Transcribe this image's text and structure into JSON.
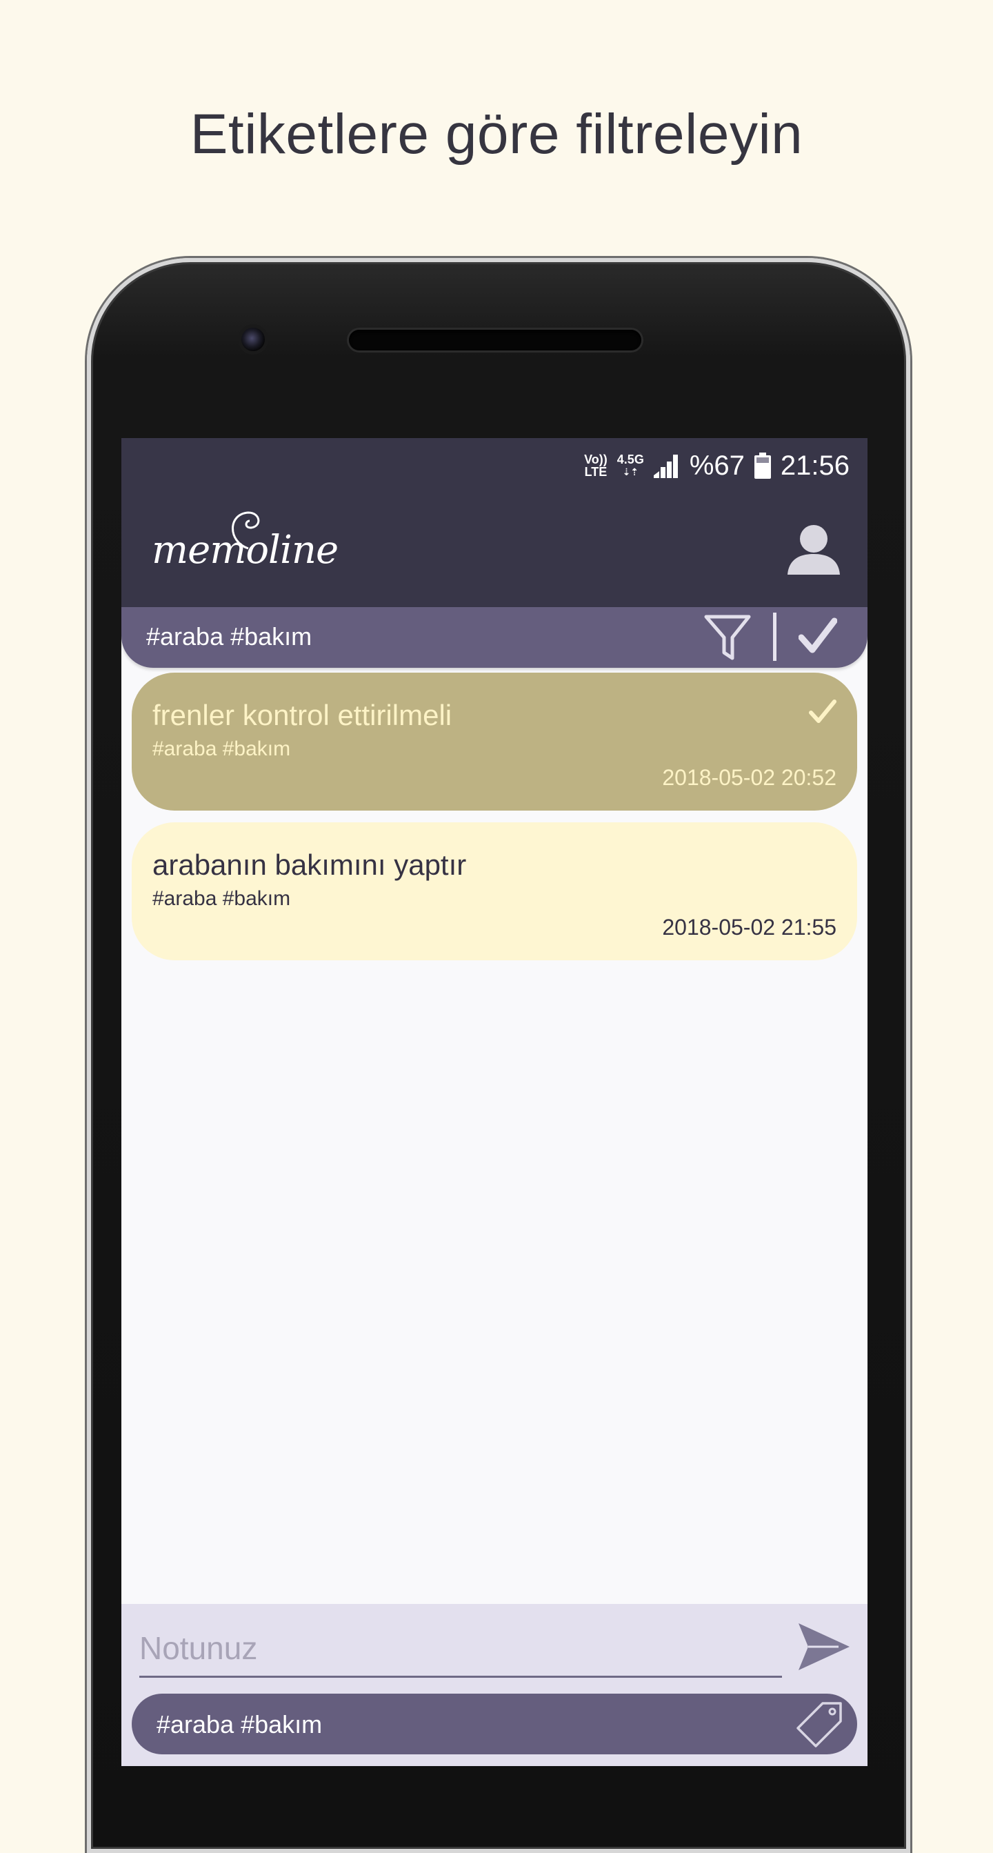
{
  "headline": "Etiketlere göre filtreleyin",
  "status_bar": {
    "volte_top": "Vo))",
    "volte_bottom": "LTE",
    "network": "4.5G",
    "battery": "%67",
    "time": "21:56"
  },
  "app_bar": {
    "logo": "memoline"
  },
  "filter_bar": {
    "tags": "#araba #bakım"
  },
  "notes": [
    {
      "title": "frenler kontrol ettirilmeli",
      "tags": "#araba #bakım",
      "date": "2018-05-02 20:52",
      "done": true
    },
    {
      "title": "arabanın bakımını yaptır",
      "tags": "#araba #bakım",
      "date": "2018-05-02 21:55",
      "done": false
    }
  ],
  "compose": {
    "placeholder": "Notunuz",
    "tags": "#araba #bakım"
  },
  "colors": {
    "page_bg": "#fdf9ec",
    "app_bar": "#383648",
    "filter_bar": "#655e7e",
    "note_done": "#bdb283",
    "note_open": "#fef6d2",
    "compose_bg": "#e3e0ee"
  }
}
